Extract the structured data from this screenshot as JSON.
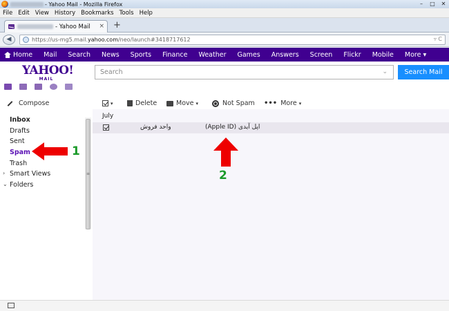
{
  "browser": {
    "window_title": "- Yahoo Mail - Mozilla Firefox",
    "menu": [
      "File",
      "Edit",
      "View",
      "History",
      "Bookmarks",
      "Tools",
      "Help"
    ],
    "tab_title": "- Yahoo Mail",
    "tab_close": "×",
    "new_tab": "+",
    "url_prefix": "https://us-mg5.mail.",
    "url_domain": "yahoo.com",
    "url_suffix": "/neo/launch#3418717612",
    "window_buttons": [
      "–",
      "□",
      "✕"
    ]
  },
  "nav": {
    "items": [
      "Home",
      "Mail",
      "Search",
      "News",
      "Sports",
      "Finance",
      "Weather",
      "Games",
      "Answers",
      "Screen",
      "Flickr",
      "Mobile",
      "More ▾"
    ]
  },
  "header": {
    "logo_text": "YAHOO!",
    "logo_sub": "MAIL",
    "search_placeholder": "Search",
    "search_button": "Search Mail"
  },
  "toolbar": {
    "compose": "Compose",
    "delete": "Delete",
    "move": "Move",
    "not_spam": "Not Spam",
    "more": "More"
  },
  "sidebar": {
    "folders": [
      "Inbox",
      "Drafts",
      "Sent",
      "Spam",
      "Trash"
    ],
    "smart_views": "Smart Views",
    "folders_label": "Folders"
  },
  "messages": {
    "group": "July",
    "rows": [
      {
        "sender": "واحد فروش",
        "subject": "اپل آیدی (Apple ID)",
        "checked": true
      }
    ]
  },
  "annotations": {
    "label_1": "1",
    "label_2": "2",
    "color_arrow": "#ee0000",
    "color_number": "#1b9a2a"
  },
  "colors": {
    "nav_bg": "#400090",
    "search_button": "#188fff",
    "spam_text": "#5c13b5"
  }
}
